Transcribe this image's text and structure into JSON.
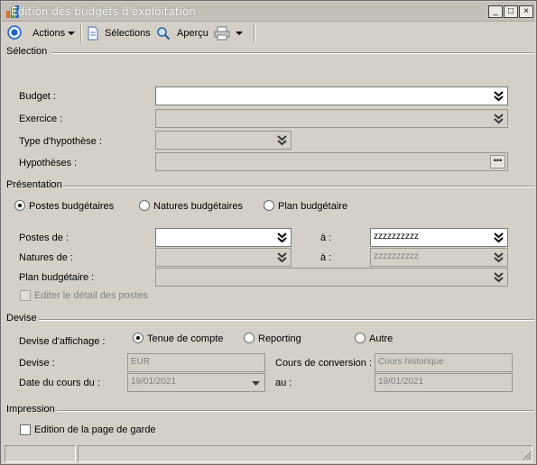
{
  "window": {
    "title": "Edition des budgets d'exploitation"
  },
  "titlebar_buttons": {
    "minimize": "_",
    "maximize": "□",
    "close": "×"
  },
  "toolbar": {
    "actions_label": "Actions",
    "selections_label": "Sélections",
    "apercu_label": "Aperçu"
  },
  "selection": {
    "section_label": "Sélection",
    "budget_label": "Budget :",
    "budget_value": "",
    "exercice_label": "Exercice :",
    "exercice_value": "",
    "type_label": "Type d'hypothèse :",
    "type_value": "",
    "hypotheses_label": "Hypothèses :",
    "hypotheses_value": "",
    "dots": "•••"
  },
  "presentation": {
    "section_label": "Présentation",
    "radio_postes": "Postes budgétaires",
    "radio_natures": "Natures budgétaires",
    "radio_plan": "Plan budgétaire",
    "postes_de_label": "Postes de :",
    "postes_de_value": "",
    "postes_a_label": "à :",
    "postes_a_value": "zzzzzzzzzz",
    "natures_de_label": "Natures de :",
    "natures_de_value": "",
    "natures_a_label": "à :",
    "natures_a_value": "zzzzzzzzzz",
    "plan_label": "Plan budgétaire :",
    "plan_value": "",
    "detail_label": "Editer le détail des postes"
  },
  "devise": {
    "section_label": "Devise",
    "affichage_label": "Devise d'affichage :",
    "radio_tenue": "Tenue de compte",
    "radio_reporting": "Reporting",
    "radio_autre": "Autre",
    "devise_label": "Devise :",
    "devise_value": "EUR",
    "cours_label": "Cours de conversion :",
    "cours_value": "Cours historique",
    "date_label": "Date du cours du :",
    "date_value": "19/01/2021",
    "au_label": "au :",
    "au_value": "19/01/2021"
  },
  "impression": {
    "section_label": "Impression",
    "garde_label": "Edition de la page de garde"
  },
  "colors": {
    "accent": "#1f5fbf",
    "panel": "#d4d0c8"
  }
}
